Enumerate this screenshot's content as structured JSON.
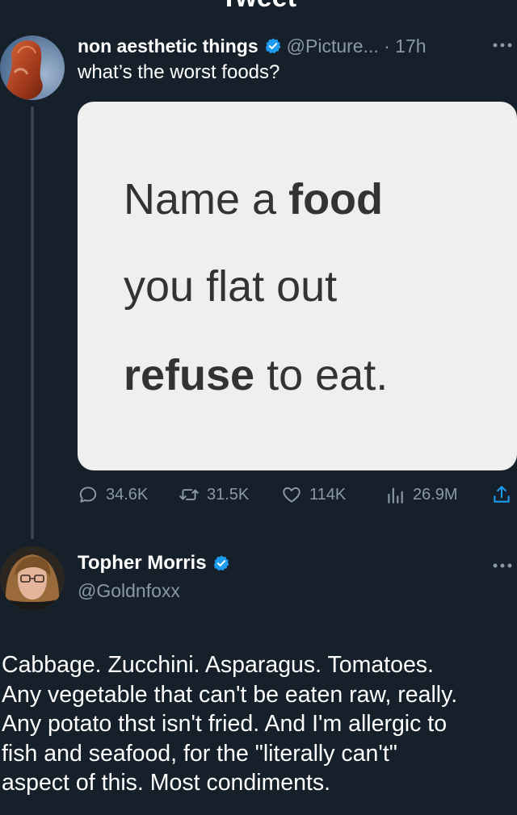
{
  "header": {
    "title": "Tweet"
  },
  "tweet": {
    "author_name": "non aesthetic things",
    "handle_time": "@Picture... · 17h",
    "text": "what’s the worst foods?",
    "media_lines": [
      {
        "prefix": "Name a ",
        "bold": "food",
        "suffix": ""
      },
      {
        "prefix": "you flat out",
        "bold": "",
        "suffix": ""
      },
      {
        "prefix": "",
        "bold": "refuse",
        "suffix": " to eat."
      }
    ],
    "stats": {
      "replies": "34.6K",
      "retweets": "31.5K",
      "likes": "114K",
      "views": "26.9M"
    }
  },
  "reply": {
    "author_name": "Topher Morris",
    "handle": "@Goldnfoxx",
    "lines": [
      "Cabbage. Zucchini. Asparagus. Tomatoes.",
      "Any vegetable that can't be eaten raw, really.",
      "Any potato thst isn't fried.  And I'm allergic to",
      "fish and seafood, for the \"literally can't\"",
      "aspect of this.  Most condiments."
    ]
  },
  "colors": {
    "background": "#15202b",
    "secondary_text": "#8b98a5",
    "verified": "#1d9bf0",
    "media_background": "#efefef"
  }
}
